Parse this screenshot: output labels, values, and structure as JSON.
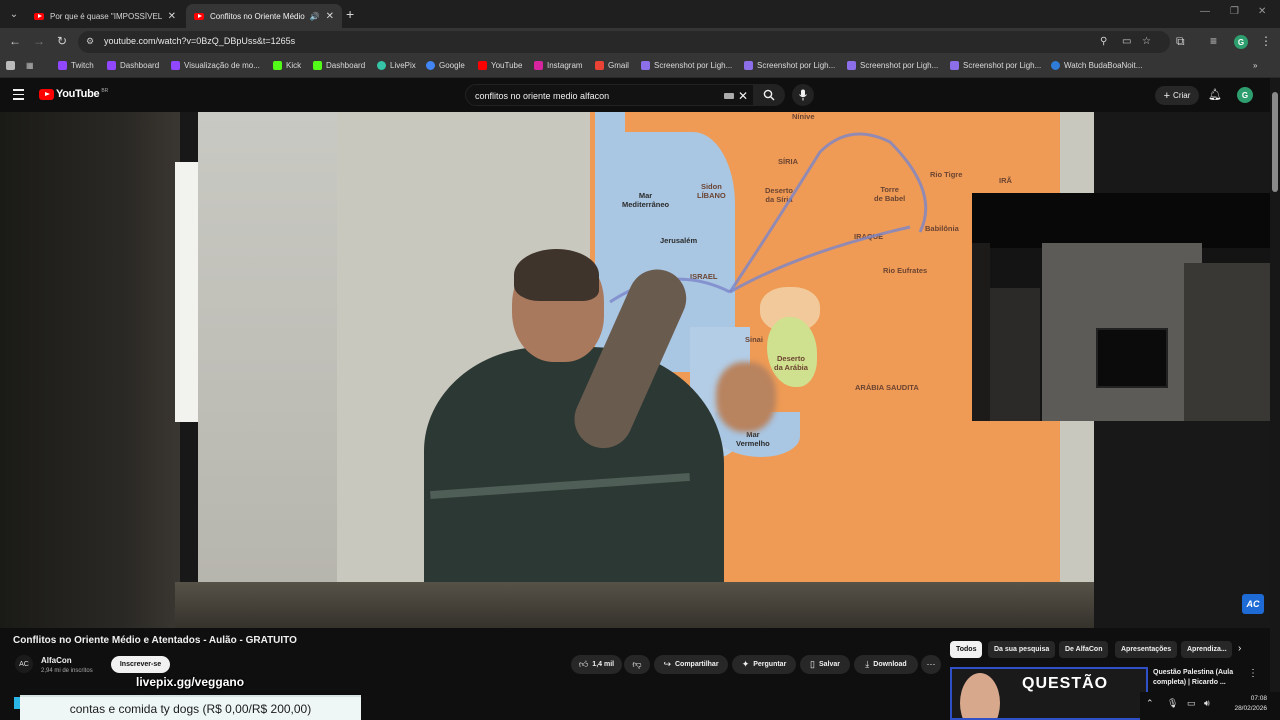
{
  "browser": {
    "tabs": [
      {
        "title": "Por que é quase \"IMPOSSÍVEL\"",
        "active": false
      },
      {
        "title": "Conflitos no Oriente Médio",
        "active": true
      }
    ],
    "url": "youtube.com/watch?v=0BzQ_DBpUss&t=1265s",
    "profile_initial": "G",
    "bookmarks": [
      {
        "label": "Twitch",
        "color": "#9146ff"
      },
      {
        "label": "Dashboard",
        "color": "#9146ff"
      },
      {
        "label": "Visualização de mo...",
        "color": "#9146ff"
      },
      {
        "label": "Kick",
        "color": "#53fc18"
      },
      {
        "label": "Dashboard",
        "color": "#53fc18"
      },
      {
        "label": "LivePix",
        "color": "#35c4a8"
      },
      {
        "label": "Google",
        "color": "#4285f4"
      },
      {
        "label": "YouTube",
        "color": "#ff0000"
      },
      {
        "label": "Instagram",
        "color": "#d6249f"
      },
      {
        "label": "Gmail",
        "color": "#ea4335"
      },
      {
        "label": "Screenshot por Ligh...",
        "color": "#8c6fe8"
      },
      {
        "label": "Screenshot por Ligh...",
        "color": "#8c6fe8"
      },
      {
        "label": "Screenshot por Ligh...",
        "color": "#8c6fe8"
      },
      {
        "label": "Screenshot por Ligh...",
        "color": "#8c6fe8"
      },
      {
        "label": "Watch BudaBoaNoit...",
        "color": "#2f7bd8"
      }
    ]
  },
  "youtube": {
    "logo_text": "YouTube",
    "logo_country": "BR",
    "search_query": "conflitos no oriente medio alfacon",
    "create_label": "Criar",
    "avatar_initial": "G"
  },
  "video": {
    "map_labels": {
      "siria": "SÍRIA",
      "ira": "IRÃ",
      "libano": "Sidon\nLÍBANO",
      "mar_med": "Mar\nMediterrâneo",
      "deserto_siria": "Deserto\nda Síria",
      "torre": "Torre\nde Babel",
      "rio_tigre": "Rio Tigre",
      "jerusalem": "Jerusalém",
      "iraque": "IRAQUE",
      "babilonia": "Babilônia",
      "rio_eufrates": "Rio Eufrates",
      "israel": "ISRAEL",
      "sinai": "Sinai",
      "deserto_arabia": "Deserto\nda Arábia",
      "arabia_saudita": "ARÁBIA SAUDITA",
      "mar_vermelho": "Mar\nVermelho",
      "nineve": "Nínive"
    },
    "channel_watermark": "AC",
    "title": "Conflitos no Oriente Médio e Atentados - Aulão - GRATUITO",
    "channel": "AlfaCon",
    "subscribers": "2,94 mi de inscritos",
    "subscribe_label": "Inscrever-se",
    "likes": "1,4 mil",
    "share_label": "Compartilhar",
    "ask_label": "Perguntar",
    "save_label": "Salvar",
    "download_label": "Download"
  },
  "chips": [
    "Todos",
    "Da sua pesquisa",
    "De AlfaCon",
    "Apresentações",
    "Aprendiza..."
  ],
  "recommendation": {
    "thumb_text": "QUESTÃO",
    "title": "Questão Palestina (Aula completa) | Ricardo ..."
  },
  "overlay": {
    "url": "livepix.gg/veggano",
    "goal": "contas e comida ty dogs (R$ 0,00/R$ 200,00)"
  },
  "system": {
    "time": "07:08",
    "date": "28/02/2026"
  }
}
